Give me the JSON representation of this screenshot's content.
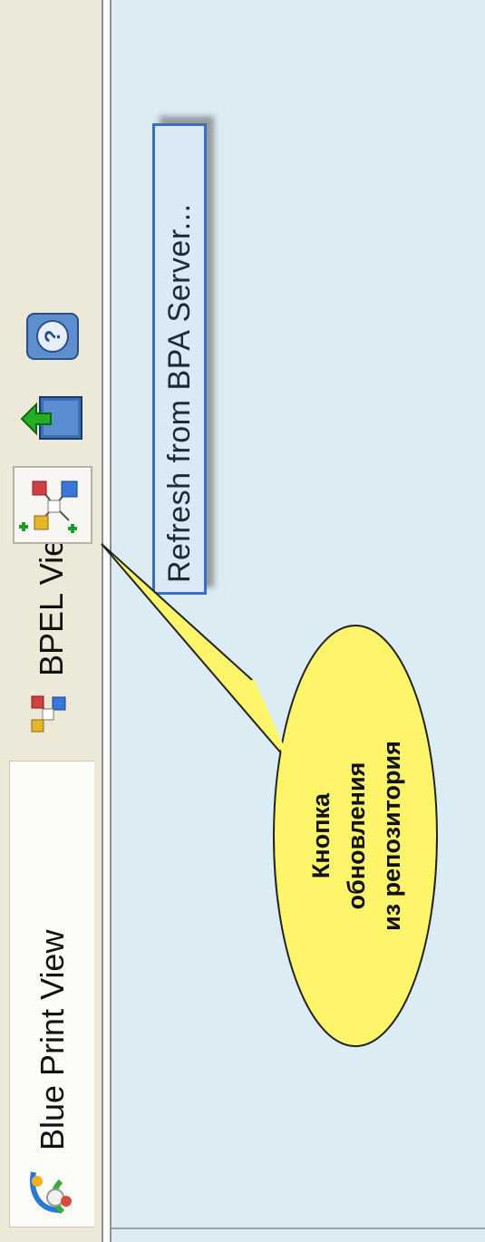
{
  "tabs": [
    {
      "label": "Blue Print View",
      "icon": "blueprint-view-icon",
      "active": true
    },
    {
      "label": "BPEL View",
      "icon": "bpel-view-icon",
      "active": false
    }
  ],
  "toolbar": {
    "refresh_icon": "refresh-from-repository-icon",
    "deploy_icon": "deploy-icon",
    "help_icon": "help-icon"
  },
  "tooltip": {
    "text": "Refresh from BPA Server..."
  },
  "callout": {
    "lines": [
      "Кнопка",
      "обновления",
      "из репозитория"
    ],
    "fill": "#fff56b"
  },
  "colors": {
    "panel": "#dcecf4",
    "tooltip_border": "#3a6fc0",
    "toolbar": "#ece9d8"
  }
}
